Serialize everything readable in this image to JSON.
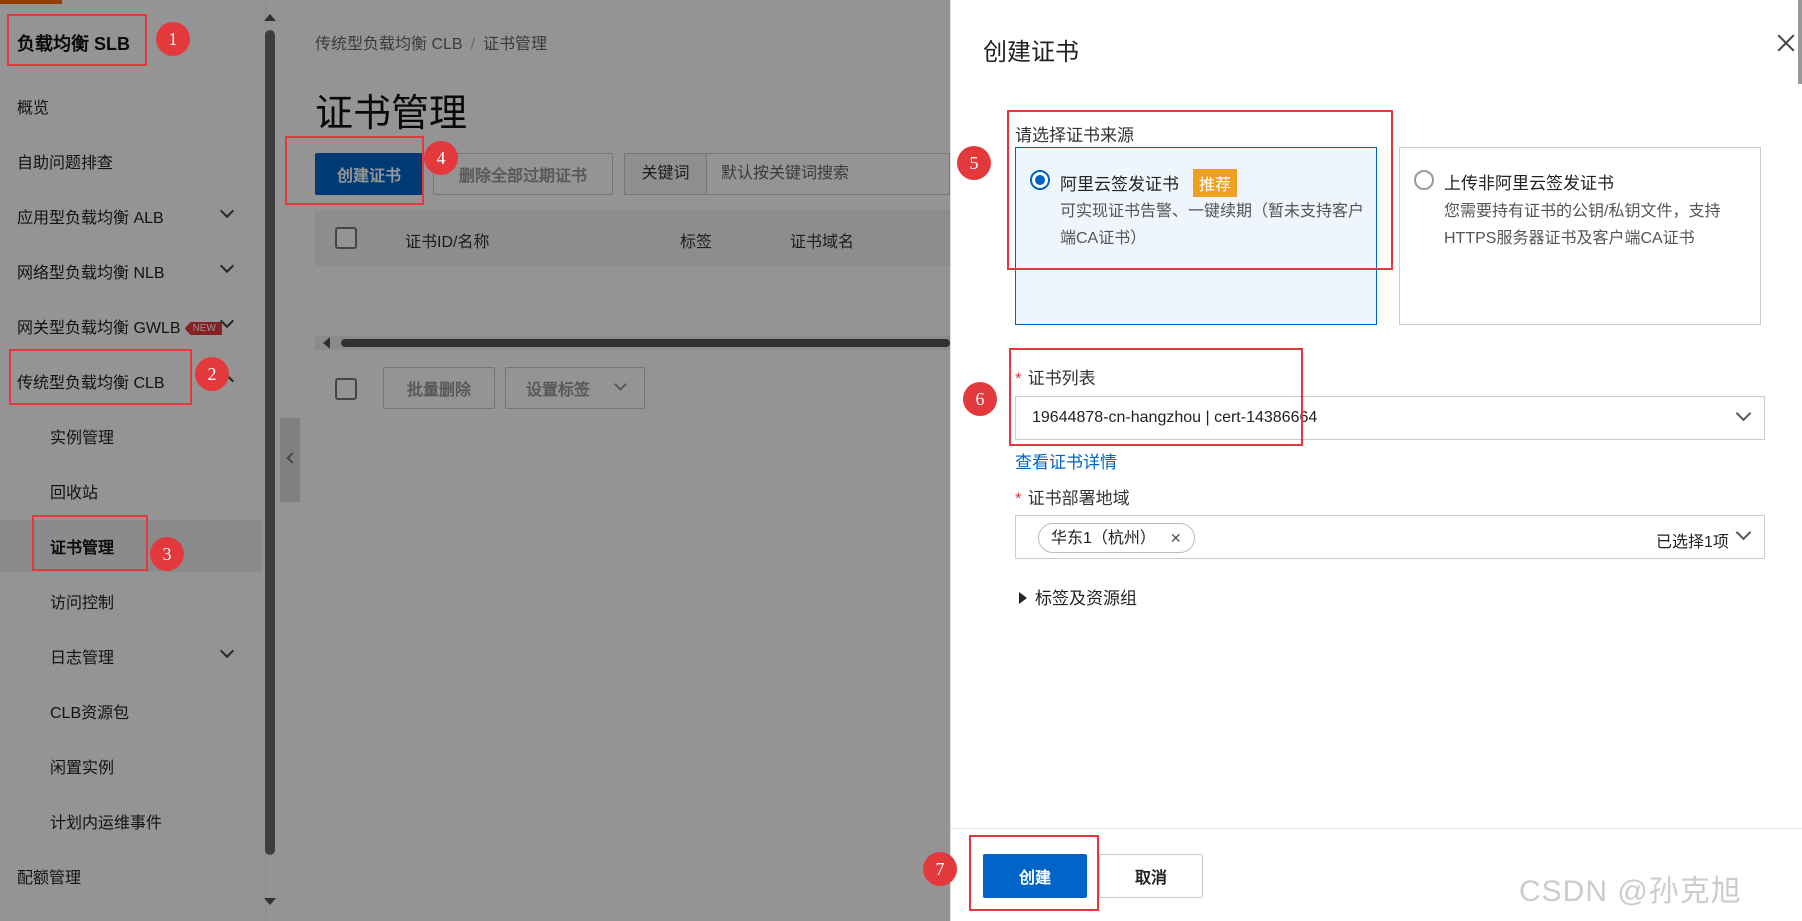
{
  "sidebar": {
    "title": "负载均衡 SLB",
    "items": [
      {
        "label": "概览"
      },
      {
        "label": "自助问题排查"
      },
      {
        "label": "应用型负载均衡 ALB"
      },
      {
        "label": "网络型负载均衡 NLB"
      },
      {
        "label": "网关型负载均衡 GWLB",
        "badge": "NEW"
      },
      {
        "label": "传统型负载均衡 CLB"
      }
    ],
    "sub_items": [
      {
        "label": "实例管理"
      },
      {
        "label": "回收站"
      },
      {
        "label": "证书管理"
      },
      {
        "label": "访问控制"
      },
      {
        "label": "日志管理"
      },
      {
        "label": "CLB资源包"
      },
      {
        "label": "闲置实例"
      },
      {
        "label": "计划内运维事件"
      }
    ],
    "bottom_item": "配额管理"
  },
  "main": {
    "breadcrumb": [
      "传统型负载均衡 CLB",
      "证书管理"
    ],
    "breadcrumb_sep": "/",
    "title": "证书管理",
    "create_button": "创建证书",
    "delete_expired_button": "删除全部过期证书",
    "search_label": "关键词",
    "search_placeholder": "默认按关键词搜索",
    "columns": [
      "证书ID/名称",
      "标签",
      "证书域名"
    ],
    "batch_delete": "批量删除",
    "set_tags": "设置标签"
  },
  "drawer": {
    "title": "创建证书",
    "source_label": "请选择证书来源",
    "sources": [
      {
        "title": "阿里云签发证书",
        "tag": "推荐",
        "desc": "可实现证书告警、一键续期（暂未支持客户端CA证书）",
        "selected": true
      },
      {
        "title": "上传非阿里云签发证书",
        "desc": "您需要持有证书的公钥/私钥文件，支持HTTPS服务器证书及客户端CA证书",
        "selected": false
      }
    ],
    "cert_list_label": "证书列表",
    "cert_list_value": "19644878-cn-hangzhou | cert-14386664",
    "view_detail_link": "查看证书详情",
    "region_label": "证书部署地域",
    "region_tag": "华东1（杭州）",
    "region_count": "已选择1项",
    "required_mark": "*",
    "tags_group_label": "标签及资源组",
    "create_button": "创建",
    "cancel_button": "取消"
  },
  "annotations": [
    "1",
    "2",
    "3",
    "4",
    "5",
    "6",
    "7"
  ],
  "watermark": "CSDN @孙克旭",
  "colors": {
    "primary": "#0064c8",
    "highlight": "#e4393c",
    "recommend": "#f0a020",
    "brand": "#ff6a00"
  }
}
